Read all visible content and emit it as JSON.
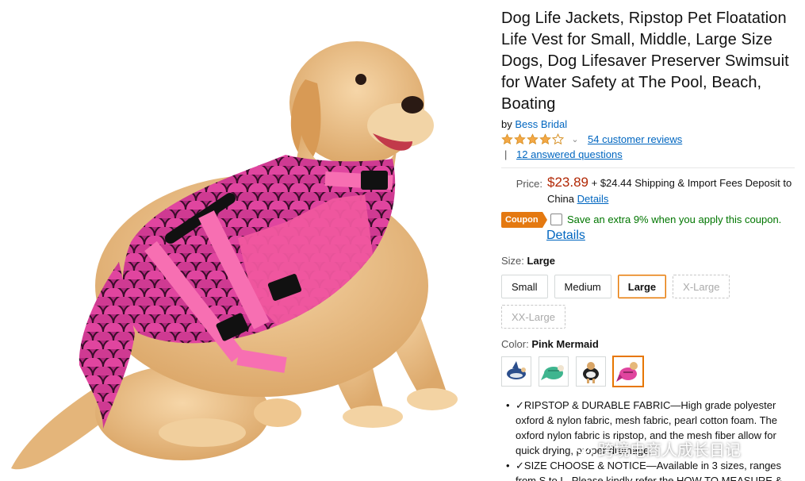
{
  "product": {
    "title": "Dog Life Jackets, Ripstop Pet Floatation Life Vest for Small, Middle, Large Size Dogs, Dog Lifesaver Preserver Swimsuit for Water Safety at The Pool, Beach, Boating",
    "by_prefix": "by",
    "brand": "Bess Bridal",
    "rating_stars": 4.0,
    "reviews_link": "54 customer reviews",
    "qa_link": "12 answered questions"
  },
  "price": {
    "label": "Price:",
    "value": "$23.89",
    "shipping_text": "+ $24.44 Shipping & Import Fees Deposit to China",
    "details_link": "Details"
  },
  "coupon": {
    "badge": "Coupon",
    "text": "Save an extra 9% when you apply this coupon.",
    "details_link": "Details"
  },
  "size": {
    "label": "Size:",
    "selected": "Large",
    "options": [
      {
        "label": "Small",
        "state": "available"
      },
      {
        "label": "Medium",
        "state": "available"
      },
      {
        "label": "Large",
        "state": "selected"
      },
      {
        "label": "X-Large",
        "state": "unavailable"
      },
      {
        "label": "XX-Large",
        "state": "unavailable"
      }
    ]
  },
  "color": {
    "label": "Color:",
    "selected": "Pink Mermaid",
    "swatches": [
      "shark-vest-icon",
      "green-mermaid-vest-icon",
      "black-white-vest-icon",
      "pink-mermaid-vest-icon"
    ]
  },
  "bullets": [
    "✓RIPSTOP & DURABLE FABRIC—High grade polyester oxford & nylon fabric, mesh fabric, pearl cotton foam. The oxford nylon fabric is ripstop, and the mesh fiber allow for quick drying, proper drainage.",
    "✓SIZE CHOOSE & NOTICE—Available in 3 sizes, ranges from S to L. Please kindly refer the HOW TO MEASURE &"
  ],
  "watermark": "跨境电商人成长日记",
  "colors": {
    "link": "#0066c0",
    "price": "#b12704",
    "coupon_badge": "#e47911",
    "coupon_text": "#007600",
    "selected_border": "#e77600",
    "star": "#f3a847"
  }
}
